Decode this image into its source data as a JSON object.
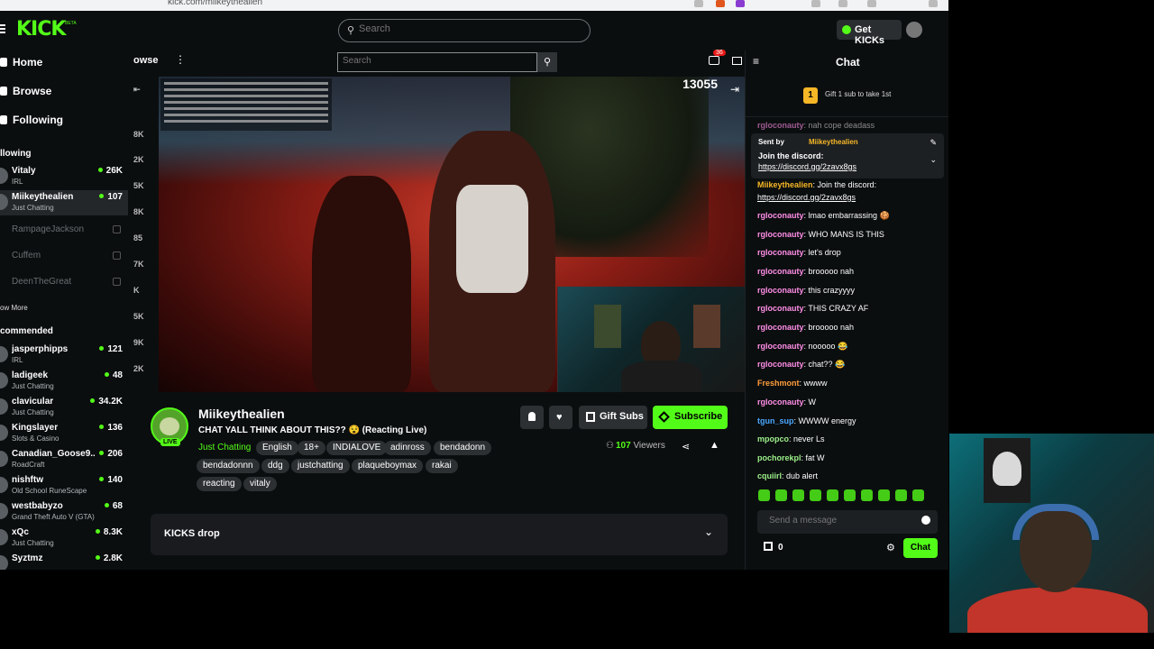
{
  "browser": {
    "url": "kick.com/miikeythealien"
  },
  "header": {
    "logo": "KICK",
    "logo_badge": "BETA",
    "search_placeholder": "Search",
    "get_kicks": "Get KICKs"
  },
  "sidebar": {
    "nav": [
      {
        "label": "Home",
        "icon": "home-icon"
      },
      {
        "label": "Browse",
        "icon": "browse-icon"
      },
      {
        "label": "Following",
        "icon": "heart-icon"
      }
    ],
    "following_title": "llowing",
    "following": [
      {
        "name": "Vitaly",
        "category": "IRL",
        "viewers": "26K"
      },
      {
        "name": "Miikeythealien",
        "category": "Just Chatting",
        "viewers": "107"
      },
      {
        "name": "RampageJackson",
        "category": "",
        "viewers": ""
      },
      {
        "name": "Cuffem",
        "category": "",
        "viewers": ""
      },
      {
        "name": "DeenTheGreat",
        "category": "",
        "viewers": ""
      }
    ],
    "show_more": "ow More",
    "recommended_title": "commended",
    "recommended": [
      {
        "name": "jasperphipps",
        "category": "IRL",
        "viewers": "121"
      },
      {
        "name": "ladigeek",
        "category": "Just Chatting",
        "viewers": "48"
      },
      {
        "name": "clavicular",
        "category": "Just Chatting",
        "viewers": "34.2K"
      },
      {
        "name": "Kingslayer",
        "category": "Slots & Casino",
        "viewers": "136"
      },
      {
        "name": "Canadian_Goose9...",
        "category": "RoadCraft",
        "viewers": "206"
      },
      {
        "name": "nishftw",
        "category": "Old School RuneScape",
        "viewers": "140"
      },
      {
        "name": "westbabyzo",
        "category": "Grand Theft Auto V (GTA)",
        "viewers": "68"
      },
      {
        "name": "xQc",
        "category": "Just Chatting",
        "viewers": "8.3K"
      },
      {
        "name": "Syztmz",
        "category": "",
        "viewers": "2.8K"
      }
    ]
  },
  "strip2": {
    "browse_label": "owse",
    "search_placeholder": "Search",
    "notif_count": "36",
    "side_counts": [
      "8K",
      "2K",
      "5K",
      "8K",
      "85",
      "7K",
      "K",
      "5K",
      "9K",
      "2K"
    ]
  },
  "video": {
    "overlay_count": "13055"
  },
  "stream": {
    "streamer": "Miikeythealien",
    "live": "LIVE",
    "title": "CHAT YALL THINK ABOUT THIS?? 😵 (Reacting Live)",
    "category": "Just Chatting",
    "tags": [
      "English",
      "18+",
      "INDIALOVE",
      "adinross",
      "bendadonn",
      "bendadonnn",
      "ddg",
      "justchatting",
      "plaqueboymax",
      "rakai",
      "reacting",
      "vitaly"
    ],
    "gift_subs": "Gift Subs",
    "subscribe": "Subscribe",
    "viewers_count": "107",
    "viewers_label": "Viewers",
    "kicks_drop": "KICKS drop"
  },
  "chat": {
    "title": "Chat",
    "gift_coin": "1",
    "gift_text": "Gift 1 sub to take 1st",
    "pinned": {
      "sent_by": "Sent by",
      "user": "Miikeythealien",
      "message": "Join the discord:",
      "link": "https://discord.gg/2zavx8gs"
    },
    "top_partial": {
      "user": "rgloconauty",
      "text": ": nah cope deadass"
    },
    "messages": [
      {
        "user": "Miikeythealien",
        "text": ": Join the discord:",
        "color": "#f6b726"
      },
      {
        "user": "",
        "text": "https://discord.gg/2zavx8gs",
        "color": "#ffffff"
      },
      {
        "user": "rgloconauty",
        "text": ": lmao embarrassing 🍪",
        "color": "#ff8ee8"
      },
      {
        "user": "rgloconauty",
        "text": ": WHO MANS IS THIS",
        "color": "#ff8ee8"
      },
      {
        "user": "rgloconauty",
        "text": ": let's drop",
        "color": "#ff8ee8"
      },
      {
        "user": "rgloconauty",
        "text": ": brooooo nah",
        "color": "#ff8ee8"
      },
      {
        "user": "rgloconauty",
        "text": ": this crazyyyy",
        "color": "#ff8ee8"
      },
      {
        "user": "rgloconauty",
        "text": ": THIS CRAZY AF",
        "color": "#ff8ee8"
      },
      {
        "user": "rgloconauty",
        "text": ": brooooo nah",
        "color": "#ff8ee8"
      },
      {
        "user": "rgloconauty",
        "text": ": nooooo 😂",
        "color": "#ff8ee8"
      },
      {
        "user": "rgloconauty",
        "text": ": chat?? 😂",
        "color": "#ff8ee8"
      },
      {
        "user": "Freshmont",
        "text": ": wwww",
        "color": "#ff9d3c"
      },
      {
        "user": "rgloconauty",
        "text": ": W",
        "color": "#ff8ee8"
      },
      {
        "user": "tgun_sup",
        "text": ": WWWW energy",
        "color": "#4aa8ff"
      },
      {
        "user": "mpopco",
        "text": ": never Ls",
        "color": "#9cf08a"
      },
      {
        "user": "pochorekpl",
        "text": ": fat W",
        "color": "#9cf08a"
      },
      {
        "user": "cquiirl",
        "text": ": dub alert",
        "color": "#9cf08a"
      }
    ],
    "send_placeholder": "Send a message",
    "kicks_count": "0",
    "chat_button": "Chat"
  },
  "colors": {
    "accent": "#53fc18",
    "background": "#0b0e0f",
    "panel": "#191b1f"
  }
}
